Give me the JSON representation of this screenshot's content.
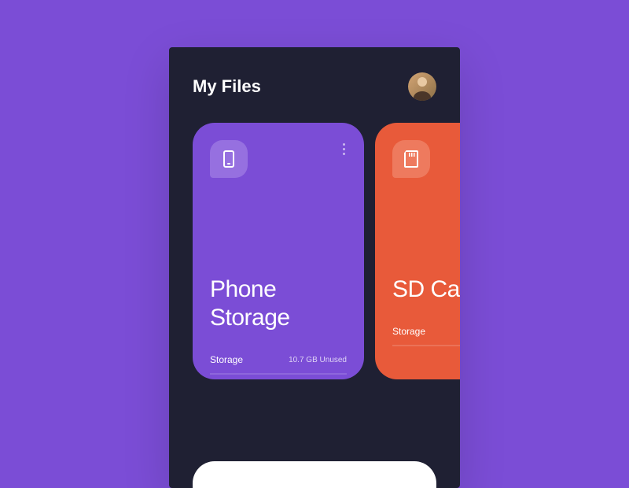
{
  "header": {
    "title": "My Files"
  },
  "cards": [
    {
      "title": "Phone Storage",
      "storage_label": "Storage",
      "storage_value": "10.7 GB Unused",
      "icon": "phone-icon",
      "color": "#7b4dd6"
    },
    {
      "title": "SD Card",
      "storage_label": "Storage",
      "storage_value": "",
      "icon": "sd-card-icon",
      "color": "#e85a3a"
    }
  ]
}
